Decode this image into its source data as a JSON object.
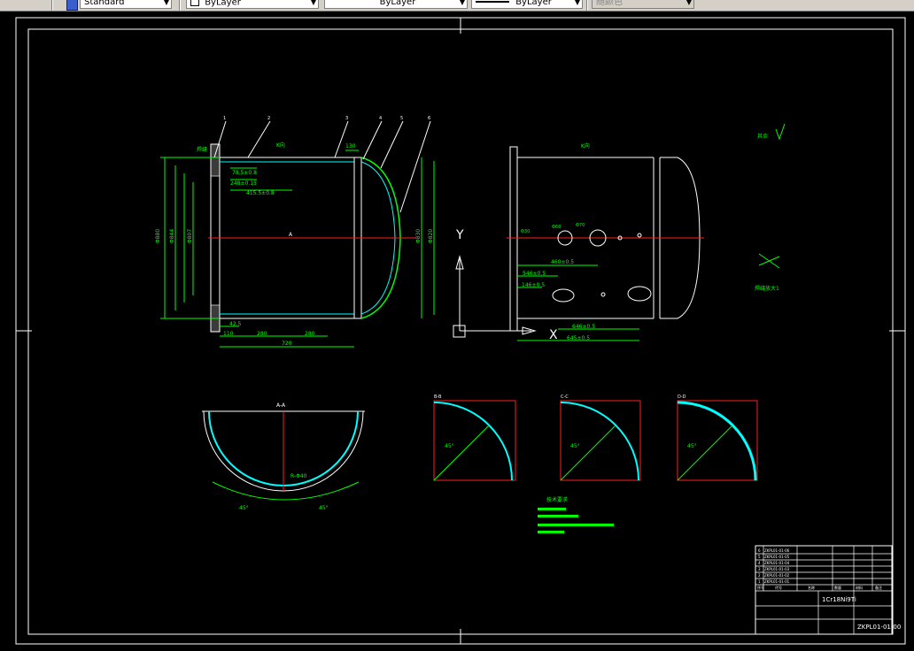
{
  "toolbar": {
    "text_style": "Standard",
    "layer": "ByLayer",
    "linetype": "ByLayer",
    "lineweight": "ByLayer",
    "plot_style": "随颜色"
  },
  "drawing": {
    "front_view": {
      "section_label": "A",
      "k_label": "K向",
      "dims": [
        "78.5±0.8",
        "248±0.15",
        "415.5±0.8",
        "130",
        "42.5",
        "110",
        "280",
        "280",
        "720"
      ],
      "vertical_dims": [
        "Φ880",
        "Φ844",
        "Φ807",
        "Φ830",
        "Φ820"
      ],
      "balloons": [
        "1",
        "2",
        "3",
        "4",
        "5",
        "6"
      ],
      "weld_label": "焊缝"
    },
    "side_view": {
      "k_label": "K向",
      "dims": [
        "460±0.5",
        "546±0.5",
        "146±0.5",
        "646±0.5",
        "645±0.5"
      ],
      "axis_y": "Y",
      "axis_x": "X",
      "hole_labels": [
        "Φ68",
        "Φ70",
        "Φ30"
      ]
    },
    "section_a": {
      "label": "A-A",
      "dim": "R-Φ40",
      "angle_left": "45°",
      "angle_right": "45°"
    },
    "section_b": {
      "label": "B-B",
      "angle": "45°"
    },
    "section_c": {
      "label": "C-C",
      "angle": "45°"
    },
    "section_d": {
      "label": "D-D",
      "angle": "45°"
    },
    "detail": {
      "label": "焊缝放大1",
      "note": "其余"
    },
    "tech_notes": {
      "title": "技术要求"
    },
    "title_block": {
      "material": "1Cr18Ni9Ti",
      "drawing_no": "ZKPL01-01-00",
      "parts": [
        {
          "no": "6",
          "code": "ZKPL01-01-06"
        },
        {
          "no": "5",
          "code": "ZKPL01-01-05"
        },
        {
          "no": "4",
          "code": "ZKPL01-01-04"
        },
        {
          "no": "3",
          "code": "ZKPL01-01-03"
        },
        {
          "no": "2",
          "code": "ZKPL01-01-02"
        },
        {
          "no": "1",
          "code": "ZKPL01-01-01"
        }
      ],
      "headers": [
        "序号",
        "代号",
        "名称",
        "数量",
        "材料",
        "备注"
      ]
    }
  }
}
